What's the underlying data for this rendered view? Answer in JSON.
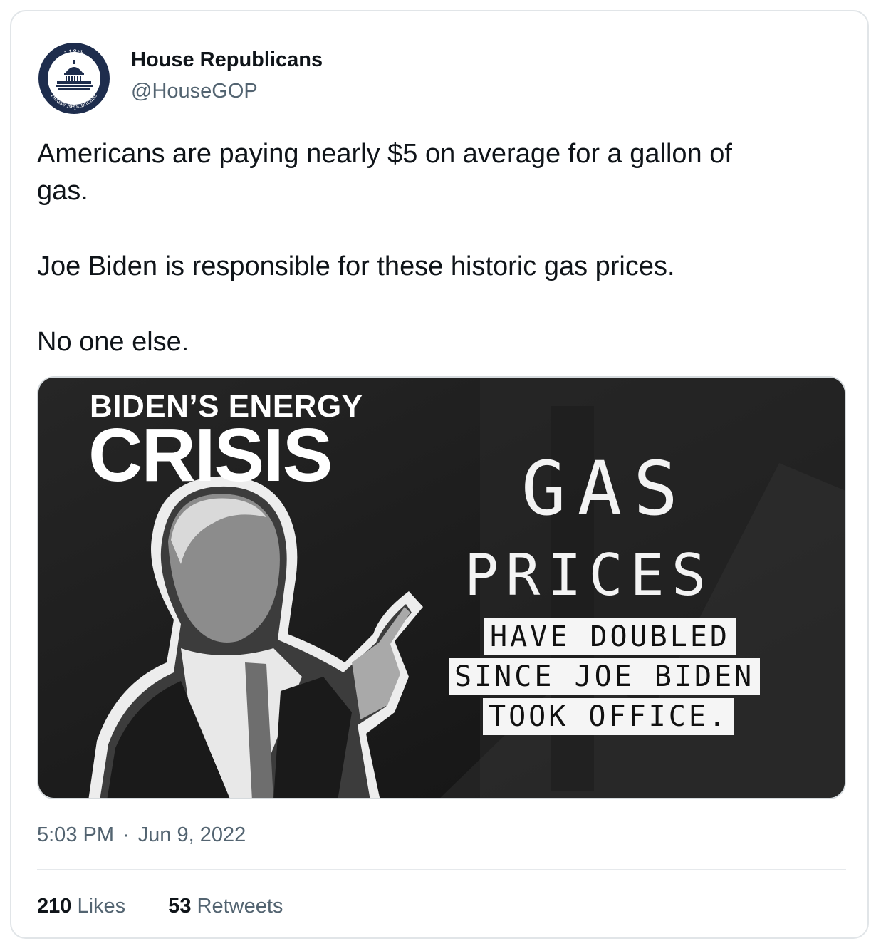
{
  "author": {
    "display_name": "House Republicans",
    "handle": "@HouseGOP",
    "avatar": {
      "icon": "capitol-seal-icon",
      "top_text": "118th",
      "ring_text": "House Republicans"
    }
  },
  "tweet": {
    "paragraphs": [
      [
        "Americans are paying nearly $5 on average for a gallon of",
        "gas."
      ],
      [
        "Joe Biden is responsible for these historic gas prices."
      ],
      [
        "No one else."
      ]
    ]
  },
  "media": {
    "headline_small": "BIDEN’S ENERGY",
    "headline_big": "CRISIS",
    "gas": "GAS",
    "prices": "PRICES",
    "strips": [
      "HAVE DOUBLED",
      "SINCE JOE BIDEN",
      "TOOK OFFICE."
    ],
    "photo_subject": "person-pointing-photo"
  },
  "meta": {
    "time": "5:03 PM",
    "separator": "·",
    "date": "Jun 9, 2022"
  },
  "stats": {
    "likes_count": "210",
    "likes_label": "Likes",
    "retweets_count": "53",
    "retweets_label": "Retweets"
  },
  "colors": {
    "text_primary": "#0f1419",
    "text_secondary": "#536471",
    "border": "#e1e5e8",
    "seal_navy": "#1e2d4d"
  }
}
